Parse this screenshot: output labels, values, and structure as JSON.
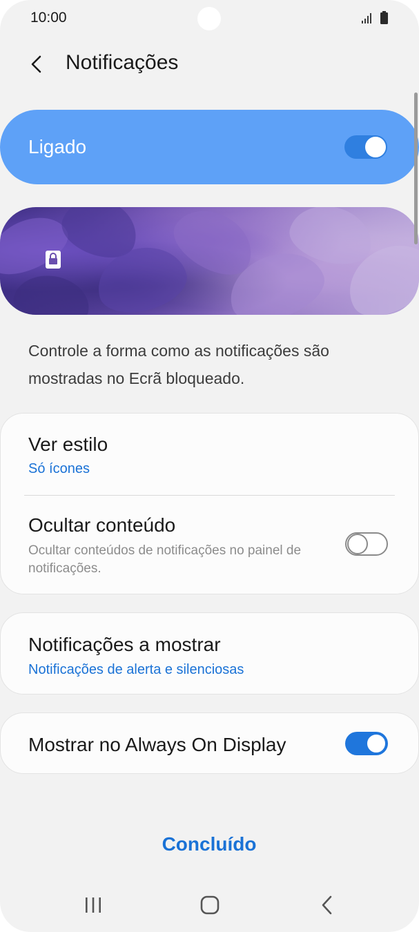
{
  "status_bar": {
    "time": "10:00"
  },
  "header": {
    "title": "Notificações",
    "back_icon": "chevron-left-icon"
  },
  "master_switch": {
    "label": "Ligado",
    "state": "on"
  },
  "preview": {
    "lock_icon": "lock-icon"
  },
  "description": "Controle a forma como as notificações são mostradas no Ecrã bloqueado.",
  "settings": {
    "view_style": {
      "title": "Ver estilo",
      "value": "Só ícones"
    },
    "hide_content": {
      "title": "Ocultar conteúdo",
      "subtitle": "Ocultar conteúdos de notificações no painel de notificações.",
      "state": "off"
    },
    "notifications_to_show": {
      "title": "Notificações a mostrar",
      "value": "Notificações de alerta e silenciosas"
    },
    "always_on_display": {
      "title": "Mostrar no Always On Display",
      "state": "on"
    }
  },
  "done_button": "Concluído",
  "nav_bar": {
    "recent_icon": "recent-apps-icon",
    "home_icon": "home-icon",
    "back_icon": "back-icon"
  },
  "colors": {
    "accent": "#1a72d6",
    "master_switch_bg": "#5ea1f7",
    "background": "#f2f2f2"
  }
}
